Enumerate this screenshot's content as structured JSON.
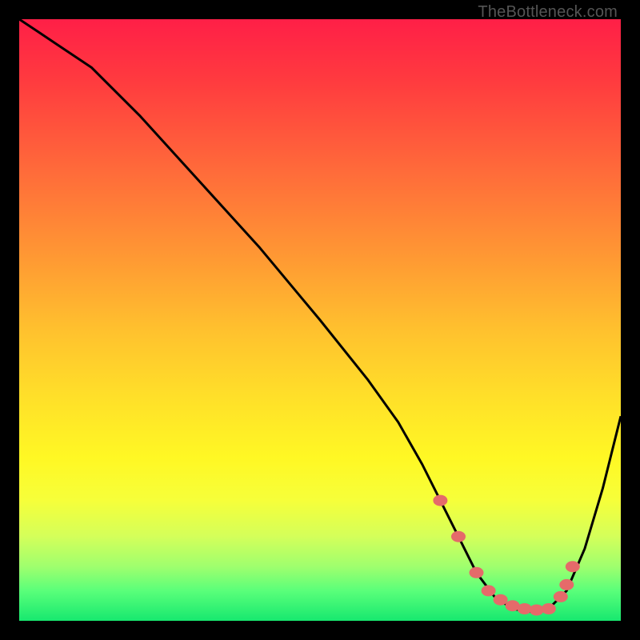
{
  "watermark": "TheBottleneck.com",
  "colors": {
    "background": "#000000",
    "gradient_top": "#ff1f47",
    "gradient_bottom": "#17e86f",
    "curve": "#000000",
    "markers": "#e56a6a"
  },
  "chart_data": {
    "type": "line",
    "title": "",
    "xlabel": "",
    "ylabel": "",
    "xlim": [
      0,
      100
    ],
    "ylim": [
      0,
      100
    ],
    "series": [
      {
        "name": "bottleneck-curve",
        "x": [
          0,
          3,
          6,
          12,
          20,
          30,
          40,
          50,
          58,
          63,
          67,
          70,
          73,
          76,
          79,
          82,
          85,
          88,
          91,
          94,
          97,
          100
        ],
        "y": [
          100,
          98,
          96,
          92,
          84,
          73,
          62,
          50,
          40,
          33,
          26,
          20,
          14,
          8,
          4,
          2,
          1.5,
          2,
          5,
          12,
          22,
          34
        ]
      }
    ],
    "markers": {
      "name": "highlight-points",
      "x": [
        70,
        73,
        76,
        78,
        80,
        82,
        84,
        86,
        88,
        90,
        91,
        92
      ],
      "y": [
        20,
        14,
        8,
        5,
        3.5,
        2.5,
        2,
        1.8,
        2,
        4,
        6,
        9
      ]
    }
  }
}
